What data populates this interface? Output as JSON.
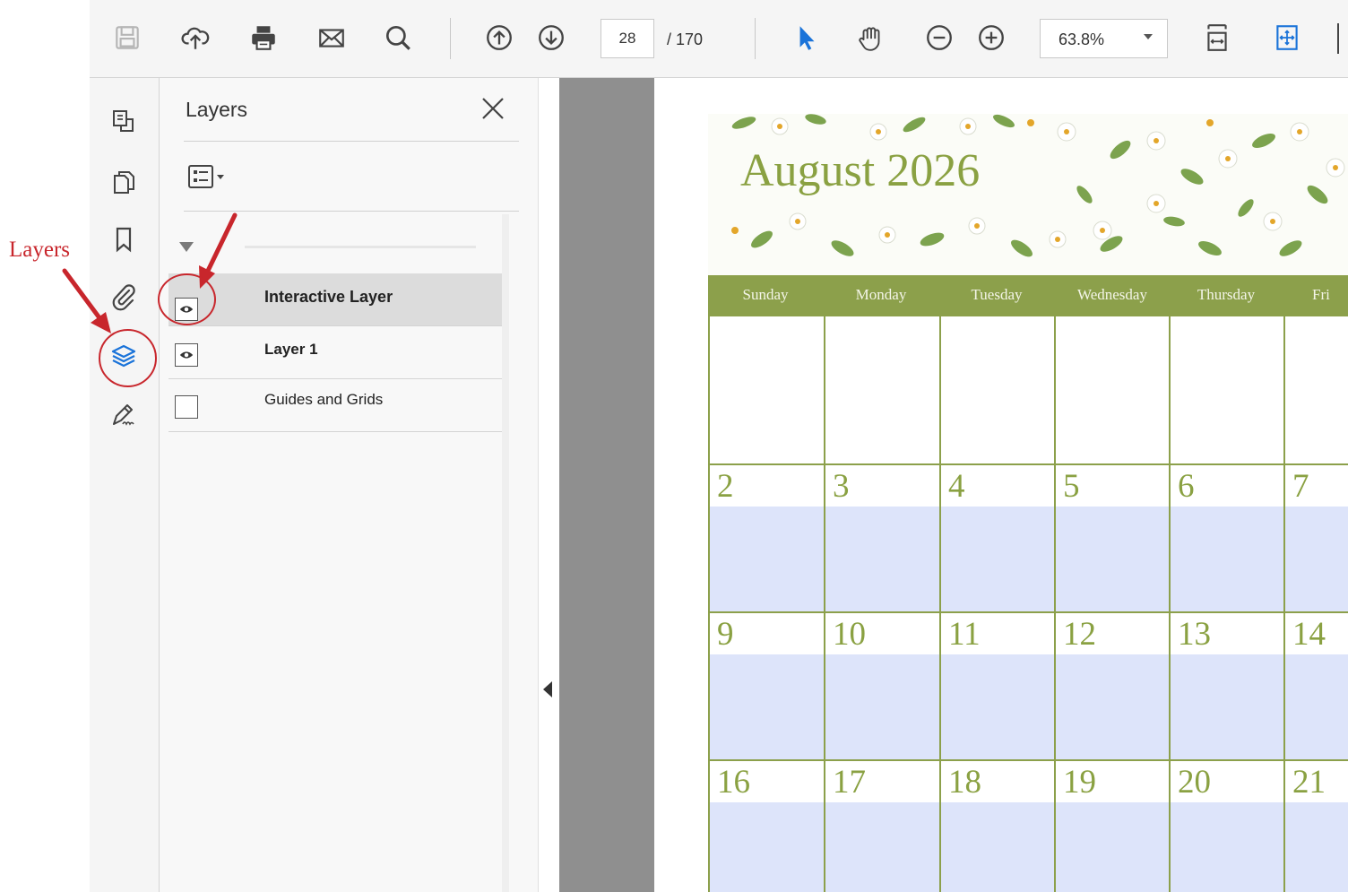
{
  "toolbar": {
    "page_current": "28",
    "page_total": "/ 170",
    "zoom": "63.8%"
  },
  "layers_panel": {
    "title": "Layers",
    "rows": [
      {
        "label": "Interactive Layer",
        "visible": true,
        "selected": true,
        "bold": true
      },
      {
        "label": "Layer 1",
        "visible": true,
        "selected": false,
        "bold": true
      },
      {
        "label": "Guides and Grids",
        "visible": false,
        "selected": false,
        "bold": false
      }
    ]
  },
  "calendar": {
    "title": "August 2026",
    "days": [
      "Sunday",
      "Monday",
      "Tuesday",
      "Wednesday",
      "Thursday",
      "Fri"
    ],
    "weeks": [
      [
        "",
        "",
        "",
        "",
        "",
        ""
      ],
      [
        "2",
        "3",
        "4",
        "5",
        "6",
        "7"
      ],
      [
        "9",
        "10",
        "11",
        "12",
        "13",
        "14"
      ],
      [
        "16",
        "17",
        "18",
        "19",
        "20",
        "21"
      ]
    ]
  },
  "annotation": {
    "label": "Layers",
    "color": "#c8262c"
  },
  "colors": {
    "accent_blue": "#1a73d9",
    "calendar_green": "#8ca04b",
    "lavender": "#dde4fa"
  }
}
